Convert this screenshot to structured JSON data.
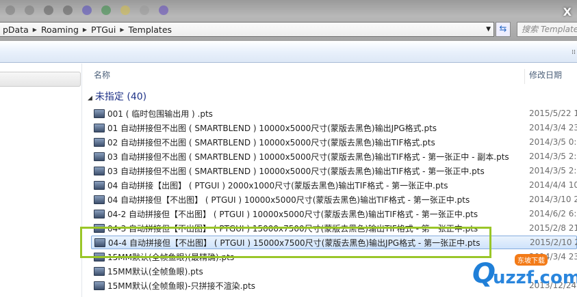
{
  "window": {
    "close_label": "X"
  },
  "address": {
    "crumbs": [
      "pData",
      "Roaming",
      "PTGui",
      "Templates"
    ],
    "search_placeholder": "搜索 Templates"
  },
  "columns": {
    "name": "名称",
    "date": "修改日期"
  },
  "group": {
    "label": "未指定 (40)"
  },
  "files": [
    {
      "name": "001 ( 临时包围输出用 ) .pts",
      "date": "2015/5/22 1"
    },
    {
      "name": "01 自动拼接但不出图 ( SMARTBLEND ) 10000x5000尺寸(蒙版去黑色)输出JPG格式.pts",
      "date": "2014/3/4 23"
    },
    {
      "name": "02 自动拼接但不出图 ( SMARTBLEND ) 10000x5000尺寸(蒙版去黑色)输出TIF格式.pts",
      "date": "2014/3/5 0:5"
    },
    {
      "name": "03 自动拼接但不出图 ( SMARTBLEND ) 10000x5000尺寸(蒙版去黑色)输出TIF格式 - 第一张正中 - 副本.pts",
      "date": "2014/3/5 2:2"
    },
    {
      "name": "03 自动拼接但不出图 ( SMARTBLEND ) 10000x5000尺寸(蒙版去黑色)输出TIF格式 - 第一张正中.pts",
      "date": "2014/3/5 2:2"
    },
    {
      "name": "04 自动拼接【出图】 ( PTGUI ) 2000x1000尺寸(蒙版去黑色)输出TIF格式 - 第一张正中.pts",
      "date": "2014/4/4 10"
    },
    {
      "name": "04 自动拼接但【不出图】 ( PTGUI ) 10000x5000尺寸(蒙版去黑色)输出TIF格式 - 第一张正中.pts",
      "date": "2014/3/10 2"
    },
    {
      "name": "04-2 自动拼接但【不出图】 ( PTGUI ) 10000x5000尺寸(蒙版去黑色)输出TIF格式 - 第一张正中.pts",
      "date": "2014/6/2 6:0"
    },
    {
      "name": "04-3 自动拼接但【不出图】 ( PTGUI ) 15000x7500尺寸(蒙版去黑色)输出TIF格式 - 第一张正中.pts",
      "date": "2015/2/8 21"
    },
    {
      "name": "04-4 自动拼接但【不出图】 ( PTGUI ) 15000x7500尺寸(蒙版去黑色)输出JPG格式 - 第一张正中.pts",
      "date": "2015/2/10 2",
      "selected": true
    },
    {
      "name": "15MM默认(全帧鱼眼)(最精确).pts",
      "date": "2014/3/4 23"
    },
    {
      "name": "15MM默认(全帧鱼眼).pts",
      "date": ""
    },
    {
      "name": "15MM默认(全帧鱼眼)-只拼接不渲染.pts",
      "date": "2013/12/24"
    }
  ],
  "watermark": {
    "text": "uzzf.com",
    "tag": "东坡下载"
  }
}
